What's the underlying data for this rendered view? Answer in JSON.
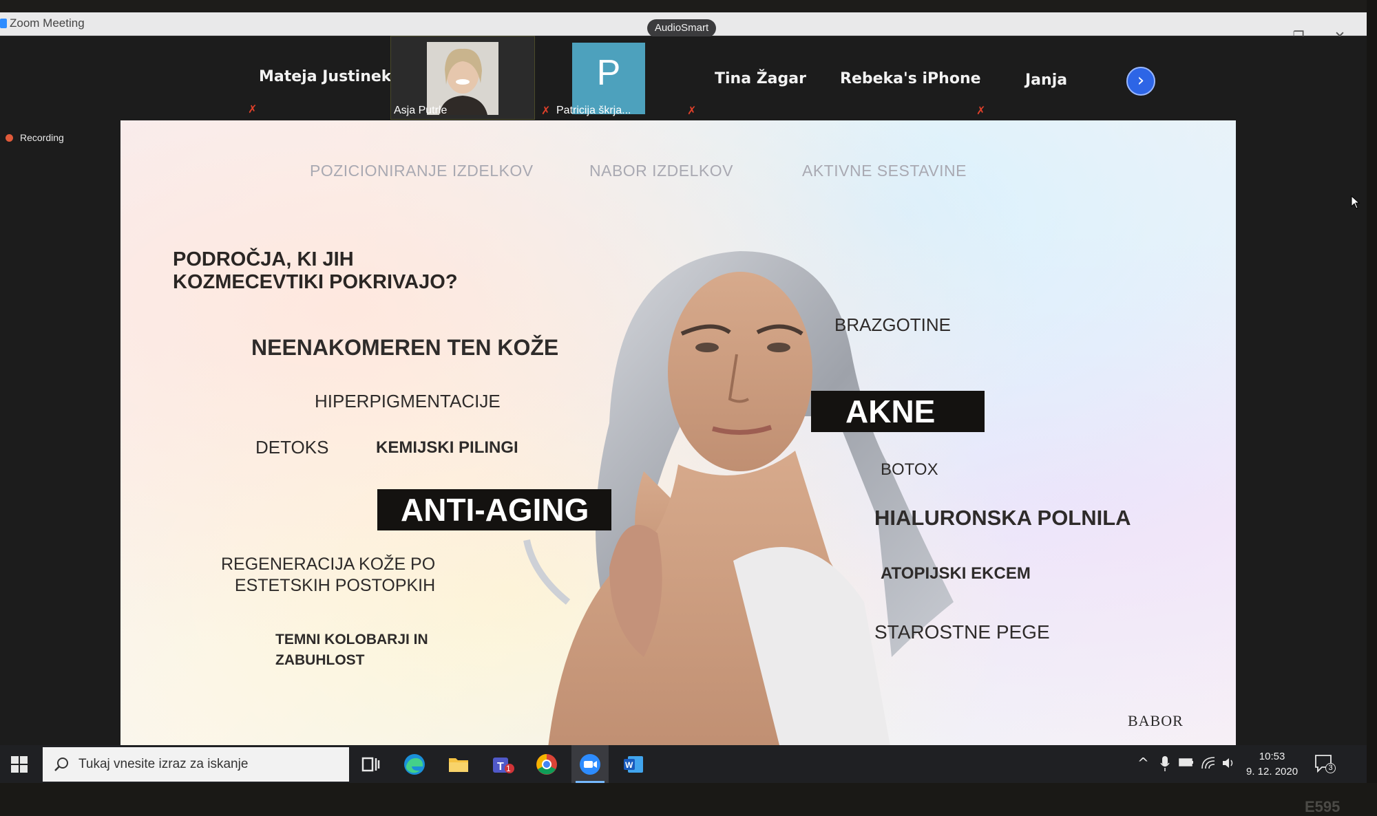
{
  "window": {
    "title": "Zoom Meeting",
    "audio_badge": "AudioSmart",
    "minimize": "–",
    "restore": "❐",
    "close": "✕"
  },
  "participants": {
    "names": [
      "Mateja Justinek",
      "Tina Žagar",
      "Rebeka's iPhone",
      "Janja"
    ],
    "tiles": [
      {
        "label": "Asja Putrle"
      },
      {
        "label": "Patricija škrja...",
        "initial": "P"
      }
    ],
    "next_icon": "chevron-right-icon"
  },
  "recording": {
    "label": "Recording"
  },
  "slide": {
    "nav": [
      "POZICIONIRANJE IZDELKOV",
      "NABOR IZDELKOV",
      "AKTIVNE SESTAVINE"
    ],
    "heading_line1": "PODROČJA, KI JIH",
    "heading_line2": "KOZMECEVTIKI POKRIVAJO?",
    "left": {
      "t1": "NEENAKOMEREN TEN KOŽE",
      "t2": "HIPERPIGMENTACIJE",
      "t3": "DETOKS",
      "t4": "KEMIJSKI PILINGI",
      "t5": "ANTI-AGING",
      "t6a": "REGENERACIJA KOŽE PO",
      "t6b": "ESTETSKIH POSTOPKIH",
      "t7a": "TEMNI KOLOBARJI IN",
      "t7b": "ZABUHLOST"
    },
    "right": {
      "r1": "BRAZGOTINE",
      "r2": "AKNE",
      "r3": "BOTOX",
      "r4": "HIALURONSKA POLNILA",
      "r5": "ATOPIJSKI EKCEM",
      "r6": "STAROSTNE PEGE"
    },
    "brand": "BABOR"
  },
  "taskbar": {
    "search_placeholder": "Tukaj vnesite izraz za iskanje",
    "apps": [
      "task-view-icon",
      "edge-icon",
      "file-explorer-icon",
      "teams-icon",
      "chrome-icon",
      "zoom-icon",
      "word-icon"
    ],
    "teams_badge": "1",
    "time": "10:53",
    "date": "9. 12. 2020",
    "notifications": "3"
  },
  "monitor_model": "E595"
}
